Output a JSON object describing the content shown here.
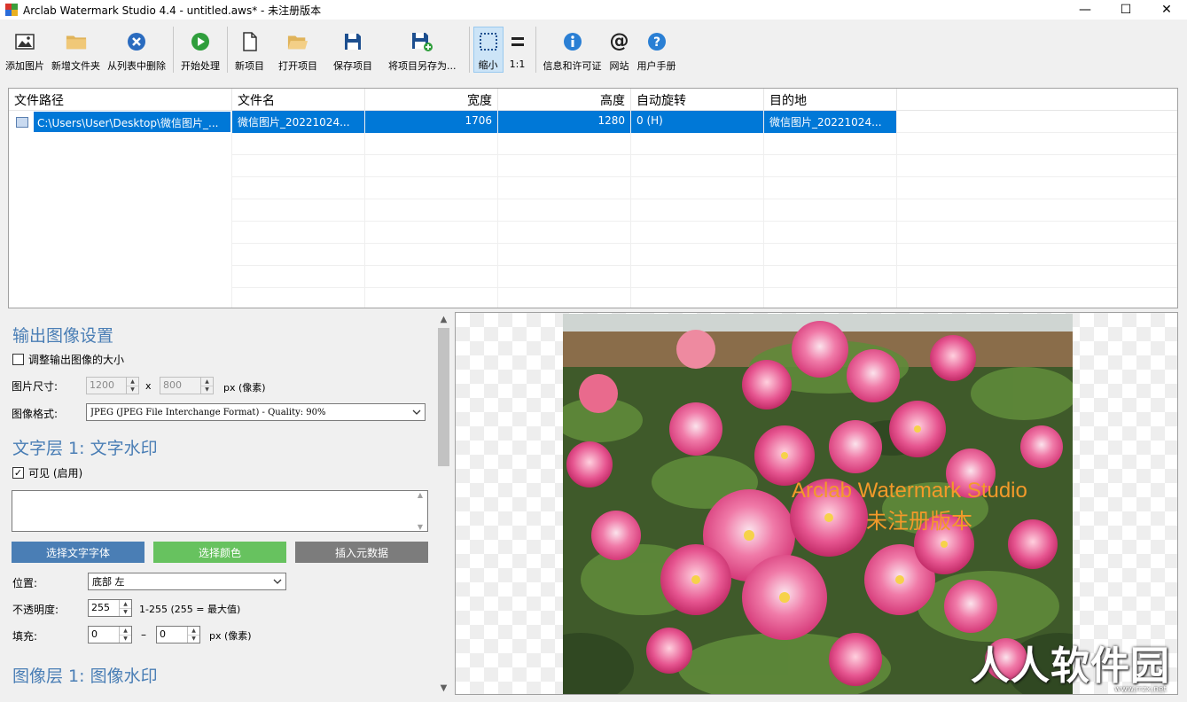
{
  "window": {
    "title": "Arclab Watermark Studio 4.4 - untitled.aws* - 未注册版本",
    "minimize": "—",
    "maximize": "☐",
    "close": "✕"
  },
  "toolbar": {
    "add_image": "添加图片",
    "add_folder": "新增文件夹",
    "remove_from_list": "从列表中删除",
    "start_processing": "开始处理",
    "new_project": "新项目",
    "open_project": "打开项目",
    "save_project": "保存项目",
    "save_project_as": "将项目另存为...",
    "shrink": "缩小",
    "one_to_one": "1:1",
    "info_license": "信息和许可证",
    "website": "网站",
    "user_manual": "用户手册"
  },
  "file_list": {
    "columns": [
      "文件路径",
      "文件名",
      "宽度",
      "高度",
      "自动旋转",
      "目的地"
    ],
    "rows": [
      [
        "C:\\Users\\User\\Desktop\\微信图片_...",
        "微信图片_20221024...",
        "1706",
        "1280",
        "0 (H)",
        "微信图片_20221024..."
      ]
    ]
  },
  "output_settings": {
    "title": "输出图像设置",
    "resize_label": "调整输出图像的大小",
    "size_label": "图片尺寸:",
    "width": "1200",
    "height": "800",
    "x_sep": "x",
    "px_unit": "px (像素)",
    "format_label": "图像格式:",
    "format_value": "JPEG (JPEG File Interchange Format) - Quality: 90%"
  },
  "text_layer": {
    "title": "文字层 1:  文字水印",
    "visible_label": "可见 (启用)",
    "text_value": "",
    "font_button": "选择文字字体",
    "color_button": "选择颜色",
    "metadata_button": "插入元数据",
    "position_label": "位置:",
    "position_value": "底部 左",
    "opacity_label": "不透明度:",
    "opacity_value": "255",
    "opacity_hint": "1-255 (255 = 最大值)",
    "fill_label": "填充:",
    "fill_x": "0",
    "fill_dash": "–",
    "fill_y": "0",
    "fill_unit": "px (像素)"
  },
  "image_layer": {
    "title": "图像层 1:  图像水印"
  },
  "preview": {
    "watermark_line1": "Arclab Watermark Studio",
    "watermark_line2": "未注册版本",
    "site_logo": "人人软件园",
    "site_sub": "www.rrzx.net"
  },
  "colors": {
    "selection": "#0078d7",
    "section_title": "#4a7eb5",
    "font_btn": "#4a7eb5",
    "color_btn": "#67c25f",
    "metadata_btn": "#7c7c7c",
    "watermark": "#f39a2a"
  }
}
